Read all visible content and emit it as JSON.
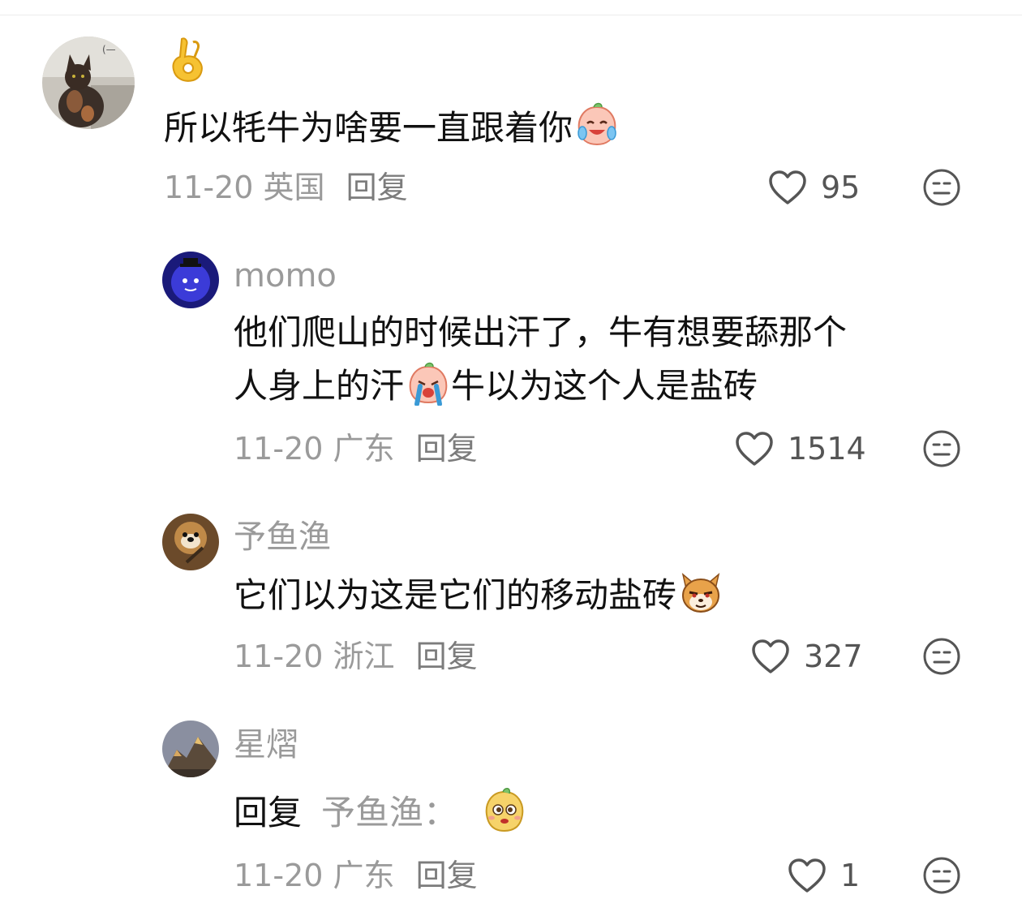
{
  "comments": [
    {
      "user": "",
      "avatar": "cat-avatar",
      "lead_emoji": "ok-hand-emoji",
      "text": "所以牦牛为啥要一直跟着你",
      "text_emoji": "crying-laughing-peach-emoji",
      "date": "11-20",
      "location": "英国",
      "reply_label": "回复",
      "likes": "95"
    }
  ],
  "replies": [
    {
      "user": "momo",
      "avatar": "blue-creature-avatar",
      "line1": "他们爬山的时候出汗了，牛有想要舔那个",
      "line2_before": "人身上的汗",
      "line2_emoji": "crying-peach-emoji",
      "line2_after": "牛以为这个人是盐砖",
      "date": "11-20",
      "location": "广东",
      "reply_label": "回复",
      "likes": "1514"
    },
    {
      "user": "予鱼渔",
      "avatar": "dog-avatar",
      "text": "它们以为这是它们的移动盐砖",
      "text_emoji": "smirking-shiba-emoji",
      "date": "11-20",
      "location": "浙江",
      "reply_label": "回复",
      "likes": "327"
    },
    {
      "user": "星熠",
      "avatar": "mountain-avatar",
      "reply_prefix": "回复",
      "reply_target": "予鱼渔：",
      "text_emoji": "cute-bean-emoji",
      "date": "11-20",
      "location": "广东",
      "reply_label": "回复",
      "likes": "1"
    }
  ],
  "colors": {
    "secondary_text": "#9a9a9a",
    "primary_text": "#111111",
    "icon": "#555555"
  }
}
